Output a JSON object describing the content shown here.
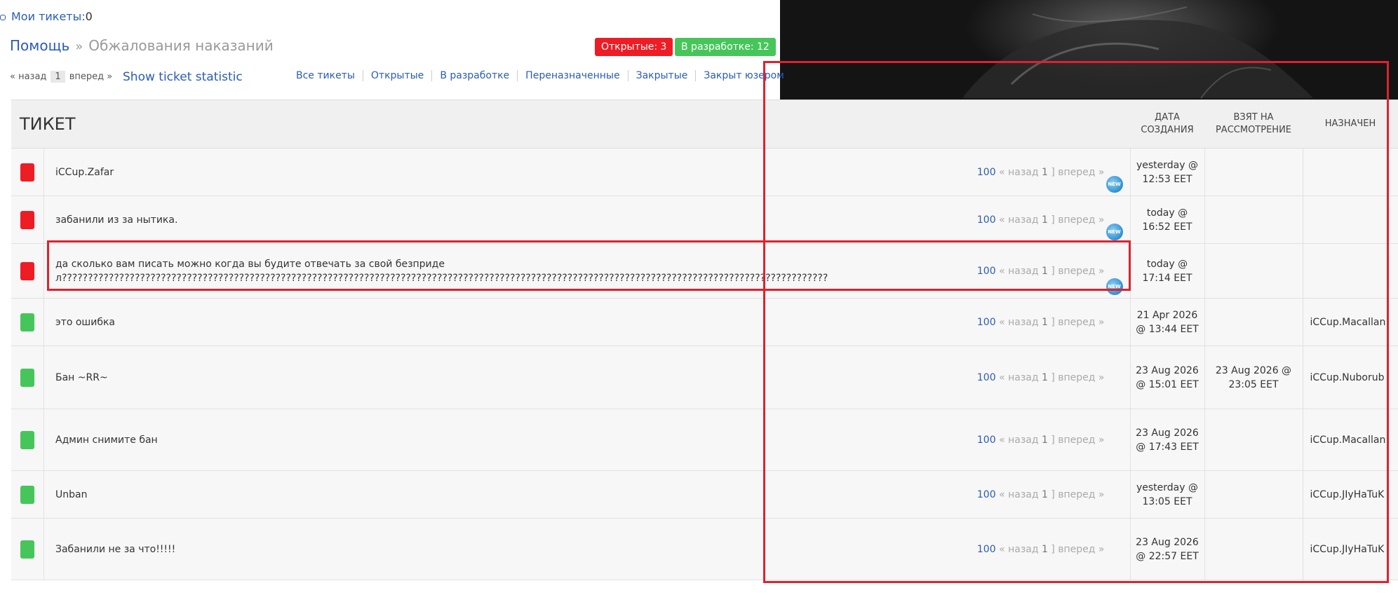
{
  "my_tickets": {
    "label": "Мои тикеты",
    "sep": ":",
    "count": "0"
  },
  "breadcrumb": {
    "help": "Помощь",
    "sep": "»",
    "current": "Обжалования наказаний"
  },
  "badges": {
    "open": "Открытые: 3",
    "dev": "В разработке: 12"
  },
  "pager": {
    "prev": "« назад",
    "page": "1",
    "next": "вперед »"
  },
  "stat_link": "Show ticket statistic",
  "filters": [
    "Все тикеты",
    "Открытые",
    "В разработке",
    "Переназначенные",
    "Закрытые",
    "Закрыт юзером"
  ],
  "table": {
    "headers": {
      "ticket": "ТИКЕТ",
      "created": "ДАТА СОЗДАНИЯ",
      "taken": "ВЗЯТ НА РАССМОТРЕНИЕ",
      "assigned": "НАЗНАЧЕН"
    },
    "row_pager": {
      "count": "100",
      "prev": "« назад",
      "page": "1",
      "bracket": "]",
      "next": "вперед »"
    },
    "new_label": "NEW",
    "rows": [
      {
        "status": "red",
        "color": "#ee1c24",
        "title": "iCCup.Zafar",
        "is_new": true,
        "created": "yesterday @ 12:53 EET",
        "taken": "",
        "assigned": ""
      },
      {
        "status": "red",
        "color": "#ee1c24",
        "title": "забанили из за нытика.",
        "is_new": true,
        "created": "today @ 16:52 EET",
        "taken": "",
        "assigned": ""
      },
      {
        "status": "red",
        "color": "#ee1c24",
        "title": "да сколько вам писать можно когда вы будите отвечать за свой безпридел???????????????????????????????????????????????????????????????????????????????????????????????????????????????????????????????????????????????????",
        "is_new": true,
        "created": "today @ 17:14 EET",
        "taken": "",
        "assigned": ""
      },
      {
        "status": "green",
        "color": "#46c65a",
        "title": "это ошибка",
        "is_new": false,
        "created": "21 Apr 2026 @ 13:44 EET",
        "taken": "",
        "assigned": "iCCup.Macallan"
      },
      {
        "status": "green",
        "color": "#46c65a",
        "title": "Бан ~RR~",
        "is_new": false,
        "created": "23 Aug 2026 @ 15:01 EET",
        "taken": "23 Aug 2026 @ 23:05 EET",
        "assigned": "iCCup.Nuborub"
      },
      {
        "status": "green",
        "color": "#46c65a",
        "title": "Админ снимите бан",
        "is_new": false,
        "created": "23 Aug 2026 @ 17:43 EET",
        "taken": "",
        "assigned": "iCCup.Macallan"
      },
      {
        "status": "green",
        "color": "#46c65a",
        "title": "Unban",
        "is_new": false,
        "created": "yesterday @ 13:05 EET",
        "taken": "",
        "assigned": "iCCup.JIyHaTuK"
      },
      {
        "status": "green",
        "color": "#46c65a",
        "title": "Забанили не за что!!!!!",
        "is_new": false,
        "created": "23 Aug 2026 @ 22:57 EET",
        "taken": "",
        "assigned": "iCCup.JIyHaTuK"
      }
    ]
  }
}
